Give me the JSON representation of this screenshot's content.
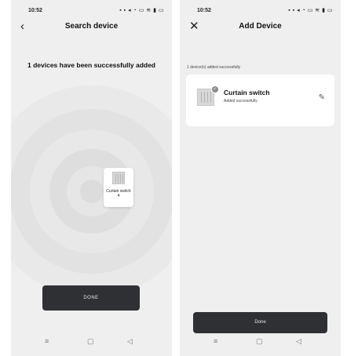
{
  "search_screen": {
    "status_time": "10:52",
    "status_icons": "▪ ▪ ◂ ◔ ▭ ≋ ▮ ▭",
    "nav_back_icon": "chevron-left-icon",
    "title": "Search device",
    "success_message": "1 devices have been successfully added",
    "device": {
      "label": "Curtain switch 4"
    },
    "done_label": "DONE",
    "system_nav": {
      "menu": "≡",
      "home": "▢",
      "back": "◁"
    }
  },
  "add_screen": {
    "status_time": "10:52",
    "status_icons": "▪ ▪ ◂ ◔ ▭ ≋ ▮ ▭",
    "nav_close_icon": "close-icon",
    "title": "Add Device",
    "added_count": "1 device(s) added successfully",
    "device_card": {
      "name": "Curtain switch",
      "status": "Added successfully"
    },
    "done_label": "Done",
    "system_nav": {
      "menu": "≡",
      "home": "▢",
      "back": "◁"
    }
  },
  "colors": {
    "screen_bg": "#efefef",
    "button_dark": "#2f3033",
    "card_bg": "#ffffff"
  }
}
